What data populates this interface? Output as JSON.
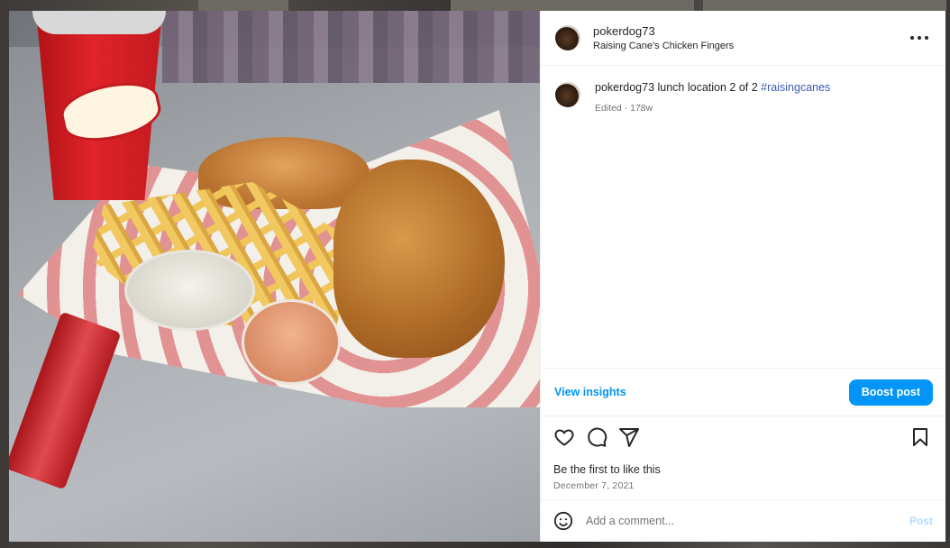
{
  "post": {
    "username": "pokerdog73",
    "location": "Raising Cane's Chicken Fingers",
    "caption": {
      "username": "pokerdog73",
      "text": " lunch location 2 of 2 ",
      "hashtag": "#raisingcanes",
      "edited": "Edited",
      "age": "178w"
    },
    "insights": {
      "view_label": "View insights",
      "boost_label": "Boost post"
    },
    "likes_text": "Be the first to like this",
    "date": "December 7, 2021",
    "comment": {
      "placeholder": "Add a comment...",
      "post_label": "Post"
    },
    "icons": {
      "more": "more-options-icon",
      "like": "heart-icon",
      "comment": "comment-icon",
      "share": "share-icon",
      "save": "bookmark-icon",
      "emoji": "emoji-icon"
    },
    "colors": {
      "accent": "#0095f6",
      "hashtag": "#3b59b6",
      "muted": "#737373",
      "post_disabled": "#b3dbff"
    }
  }
}
